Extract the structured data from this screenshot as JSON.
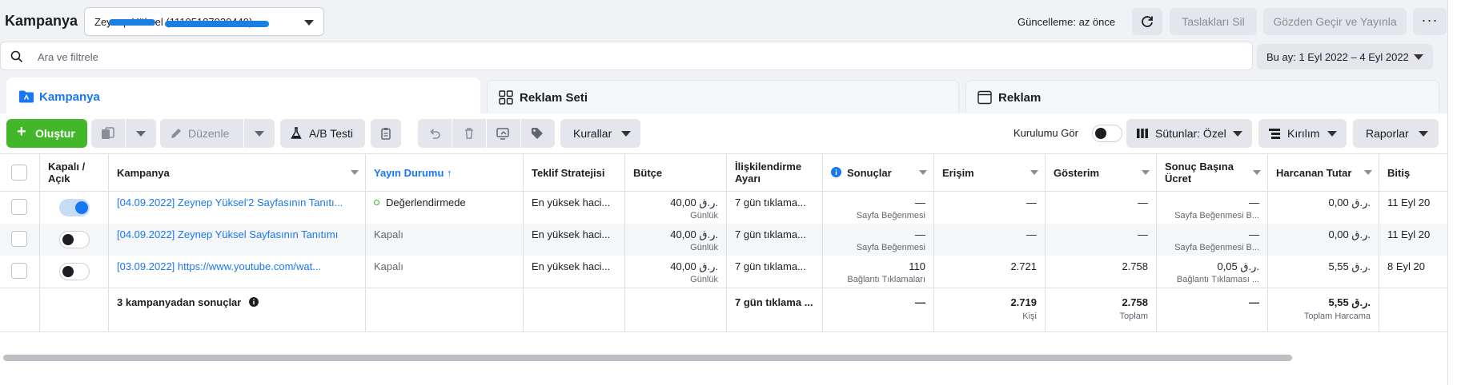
{
  "header": {
    "title": "Kampanya",
    "account_name": "Zeynep Yüksel (11105187939449)",
    "update_text": "Güncelleme: az önce",
    "discard_drafts": "Taslakları Sil",
    "review_publish": "Gözden Geçir ve Yayınla",
    "more": "···"
  },
  "search": {
    "placeholder": "Ara ve filtrele",
    "date_range": "Bu ay: 1 Eyl 2022 – 4 Eyl 2022"
  },
  "levels": {
    "campaign": "Kampanya",
    "adset": "Reklam Seti",
    "ad": "Reklam"
  },
  "toolbar": {
    "create": "Oluştur",
    "edit": "Düzenle",
    "ab_test": "A/B Testi",
    "rules": "Kurallar",
    "setup_view": "Kurulumu Gör",
    "columns": "Sütunlar: Özel",
    "breakdown": "Kırılım",
    "reports": "Raporlar"
  },
  "columns": {
    "on_off": [
      "Kapalı /",
      "Açık"
    ],
    "campaign": "Kampanya",
    "delivery": "Yayın Durumu ↑",
    "bid_strategy": "Teklif Stratejisi",
    "budget": "Bütçe",
    "attribution": [
      "İlişkilendirme",
      "Ayarı"
    ],
    "results": "Sonuçlar",
    "reach": "Erişim",
    "impressions": "Gösterim",
    "cost_per_result": [
      "Sonuç Başına",
      "Ücret"
    ],
    "amount_spent": "Harcanan Tutar",
    "ends": "Bitiş"
  },
  "rows": [
    {
      "toggle_on": true,
      "name": "[04.09.2022] Zeynep Yüksel'2 Sayfasının Tanıtı...",
      "delivery": "Değerlendirmede",
      "delivery_active": true,
      "bid": "En yüksek haci...",
      "budget": "40,00 ر.ق.",
      "budget_sub": "Günlük",
      "attribution": "7 gün tıklama...",
      "results": "—",
      "results_sub": "Sayfa Beğenmesi",
      "reach": "—",
      "impressions": "—",
      "cpr": "—",
      "cpr_sub": "Sayfa Beğenmesi B...",
      "spent": "0,00 ر.ق.",
      "ends": "11 Eyl 20"
    },
    {
      "toggle_on": false,
      "name": "[04.09.2022] Zeynep Yüksel Sayfasının Tanıtımı",
      "delivery": "Kapalı",
      "delivery_active": false,
      "bid": "En yüksek haci...",
      "budget": "40,00 ر.ق.",
      "budget_sub": "Günlük",
      "attribution": "7 gün tıklama...",
      "results": "—",
      "results_sub": "Sayfa Beğenmesi",
      "reach": "—",
      "impressions": "—",
      "cpr": "—",
      "cpr_sub": "Sayfa Beğenmesi B...",
      "spent": "0,00 ر.ق.",
      "ends": "11 Eyl 20"
    },
    {
      "toggle_on": false,
      "name": "[03.09.2022] https://www.youtube.com/wat...",
      "delivery": "Kapalı",
      "delivery_active": false,
      "bid": "En yüksek haci...",
      "budget": "40,00 ر.ق.",
      "budget_sub": "Günlük",
      "attribution": "7 gün tıklama...",
      "results": "110",
      "results_sub": "Bağlantı Tıklamaları",
      "reach": "2.721",
      "impressions": "2.758",
      "cpr": "0,05 ر.ق.",
      "cpr_sub": "Bağlantı Tıklaması ...",
      "spent": "5,55 ر.ق.",
      "ends": "8 Eyl 20"
    }
  ],
  "totals": {
    "label": "3 kampanyadan sonuçlar",
    "attribution": "7 gün tıklama ...",
    "results": "—",
    "reach": "2.719",
    "reach_sub": "Kişi",
    "impressions": "2.758",
    "impressions_sub": "Toplam",
    "cpr": "—",
    "spent": "5,55 ر.ق.",
    "spent_sub": "Toplam Harcama"
  },
  "colors": {
    "accent": "#1877f2",
    "create_green": "#42b72a",
    "status_green": "#42b72a"
  }
}
